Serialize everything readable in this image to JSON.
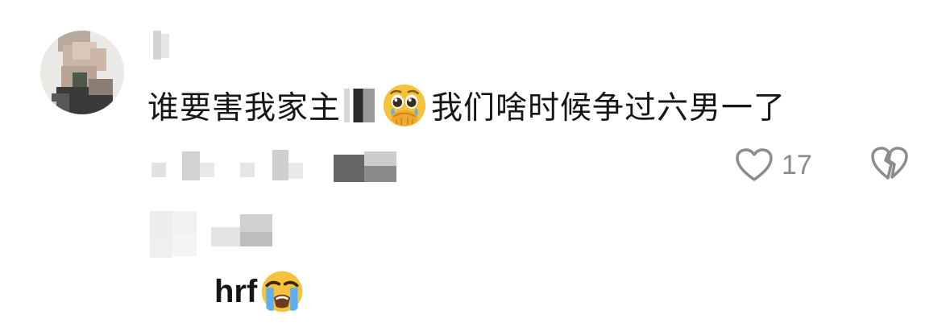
{
  "comment": {
    "author_name": "",
    "text_before": "谁要害我家主",
    "text_after": "我们啥时候争过六男一了",
    "emoji_1": "pleading-face-hands-over-mouth-emoji",
    "like_count": "17",
    "like_icon": "heart-outline-icon",
    "dislike_icon": "broken-heart-icon"
  },
  "reply": {
    "author_name": "",
    "text": "hrf",
    "emoji": "loudly-crying-face-emoji"
  }
}
